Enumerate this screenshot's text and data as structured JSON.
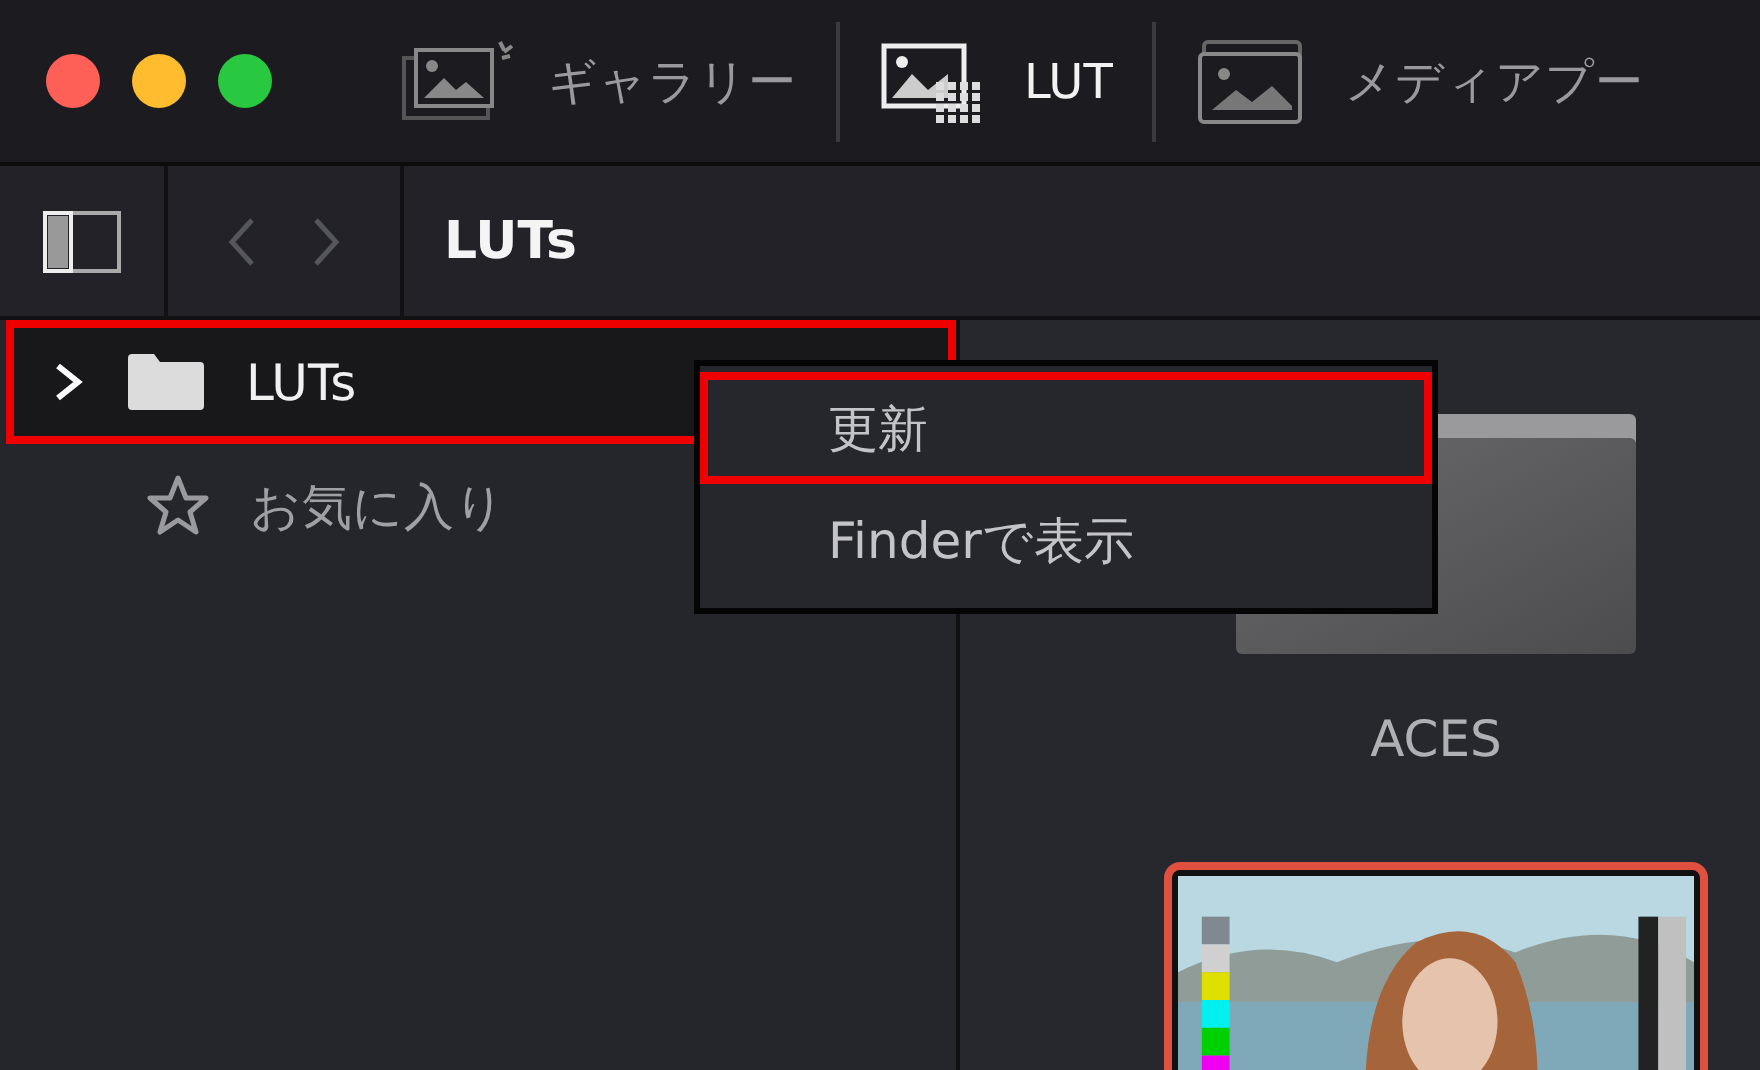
{
  "tabs": [
    {
      "label": "ギャラリー",
      "selected": false,
      "kind": "gallery"
    },
    {
      "label": "LUT",
      "selected": true,
      "kind": "lut"
    },
    {
      "label": "メディアプー",
      "selected": false,
      "kind": "media"
    }
  ],
  "toolbar": {
    "path": "LUTs"
  },
  "sidebar": {
    "items": [
      {
        "label": "LUTs",
        "kind": "folder",
        "expanded": false,
        "highlighted": true
      },
      {
        "label": "お気に入り",
        "kind": "favorites",
        "highlighted": false
      }
    ]
  },
  "context_menu": {
    "items": [
      {
        "label": "更新",
        "highlighted": true
      },
      {
        "label": "Finderで表示",
        "highlighted": false
      }
    ]
  },
  "content": {
    "items": [
      {
        "kind": "folder",
        "label": "ACES",
        "selected": false
      },
      {
        "kind": "picture",
        "selected": true
      }
    ]
  }
}
